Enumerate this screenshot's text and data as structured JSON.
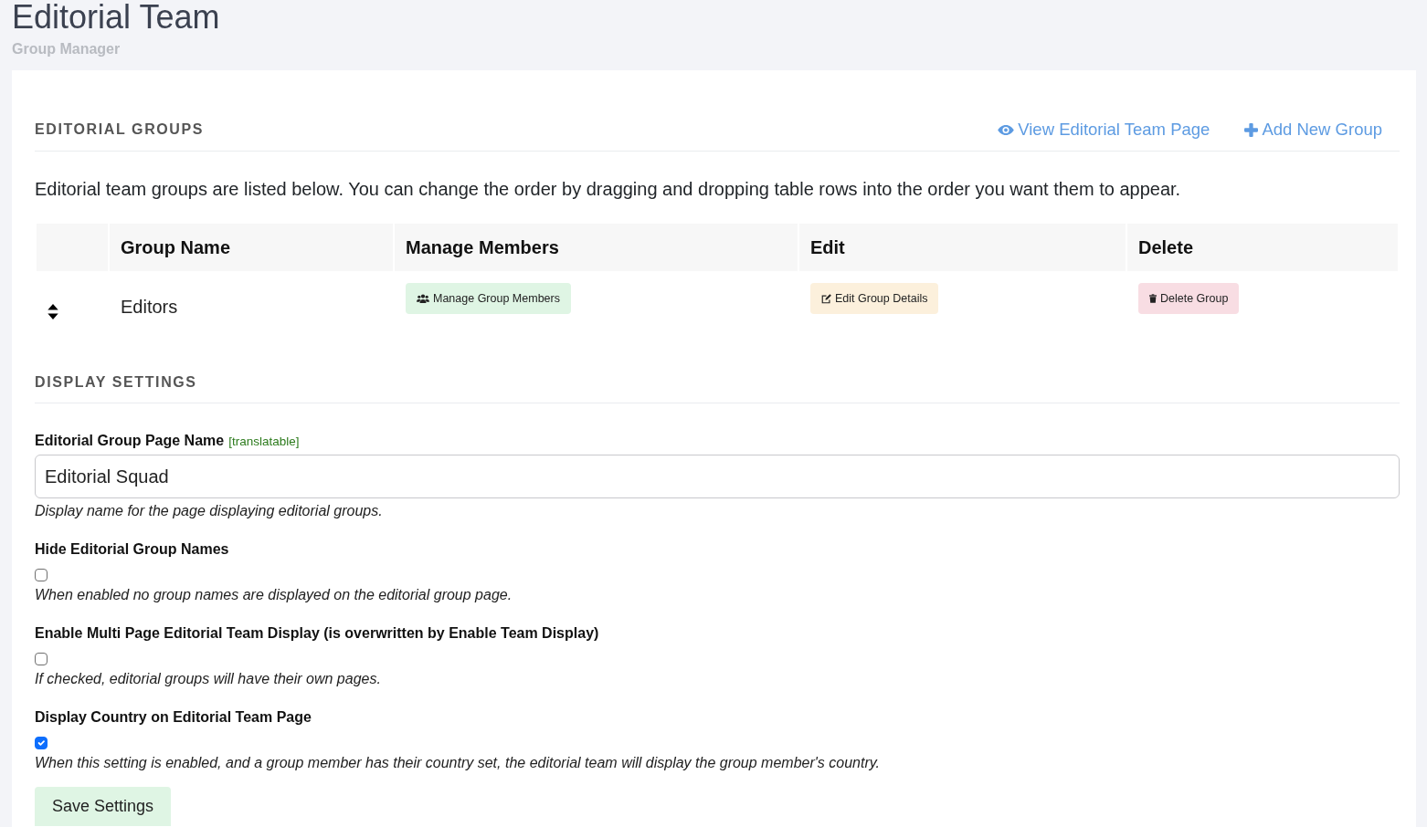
{
  "header": {
    "title": "Editorial Team",
    "subtitle": "Group Manager"
  },
  "groups_section": {
    "heading": "EDITORIAL GROUPS",
    "links": [
      {
        "kind": "view",
        "label": "View Editorial Team Page"
      },
      {
        "kind": "add",
        "label": "Add New Group"
      }
    ],
    "description": "Editorial team groups are listed below. You can change the order by dragging and dropping table rows into the order you want them to appear.",
    "table": {
      "columns": [
        "Group Name",
        "Manage Members",
        "Edit",
        "Delete"
      ],
      "rows": [
        {
          "group_name": "Editors",
          "buttons": [
            {
              "kind": "members",
              "label": "Manage Group Members"
            },
            {
              "kind": "edit",
              "label": "Edit Group Details"
            },
            {
              "kind": "delete",
              "label": "Delete Group"
            }
          ]
        }
      ]
    }
  },
  "settings_section": {
    "heading": "DISPLAY SETTINGS",
    "fields": [
      {
        "kind": "text",
        "label": "Editorial Group Page Name",
        "note": "[translatable]",
        "value": "Editorial Squad",
        "help": "Display name for the page displaying editorial groups."
      },
      {
        "kind": "checkbox",
        "label": "Hide Editorial Group Names",
        "checked": false,
        "help": "When enabled no group names are displayed on the editorial group page."
      },
      {
        "kind": "checkbox",
        "label": "Enable Multi Page Editorial Team Display (is overwritten by Enable Team Display)",
        "checked": false,
        "help": "If checked, editorial groups will have their own pages."
      },
      {
        "kind": "checkbox",
        "label": "Display Country on Editorial Team Page",
        "checked": true,
        "help": "When this setting is enabled, and a group member has their country set, the editorial team will display the group member's country."
      }
    ],
    "save_button": "Save Settings"
  }
}
